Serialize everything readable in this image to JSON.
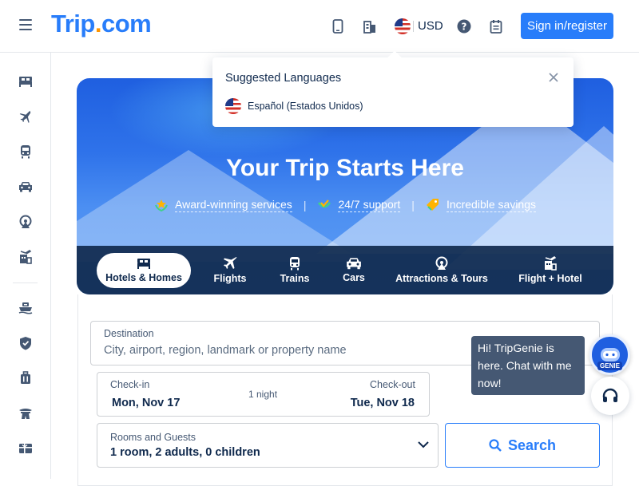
{
  "header": {
    "logo_main": "Trip",
    "logo_dot": ".",
    "logo_tld": "com",
    "currency": "USD",
    "signin_label": "Sign in/register",
    "icons": [
      "menu-icon",
      "mobile-icon",
      "building-icon",
      "us-flag-icon",
      "help-icon",
      "bookings-icon"
    ]
  },
  "sidebar": {
    "items": [
      "hotels-icon",
      "flights-icon",
      "trains-icon",
      "cars-icon",
      "attractions-icon",
      "flight-hotel-icon",
      "cruise-icon",
      "insurance-icon",
      "luggage-icon",
      "landmark-icon",
      "gift-card-icon"
    ]
  },
  "hero": {
    "title": "Your Trip Starts Here",
    "features": [
      {
        "label": "Award-winning services",
        "icon": "award-icon"
      },
      {
        "label": "24/7 support",
        "icon": "support-check-icon"
      },
      {
        "label": "Incredible savings",
        "icon": "tag-icon"
      }
    ],
    "separator": "|",
    "tabs": [
      {
        "label": "Hotels & Homes",
        "active": true
      },
      {
        "label": "Flights"
      },
      {
        "label": "Trains"
      },
      {
        "label": "Cars"
      },
      {
        "label": "Attractions & Tours"
      },
      {
        "label": "Flight + Hotel"
      }
    ]
  },
  "search": {
    "destination_label": "Destination",
    "destination_placeholder": "City, airport, region, landmark or property name",
    "checkin_label": "Check-in",
    "checkin_value": "Mon, Nov 17",
    "nights": "1 night",
    "checkout_label": "Check-out",
    "checkout_value": "Tue, Nov 18",
    "rooms_label": "Rooms and Guests",
    "rooms_value": "1 room, 2 adults, 0 children",
    "search_label": "Search"
  },
  "language_popup": {
    "title": "Suggested Languages",
    "option": "Español (Estados Unidos)"
  },
  "genie": {
    "message": "Hi! TripGenie is here. Chat with me now!",
    "badge": "GENIE"
  },
  "colors": {
    "brand": "#287dfa",
    "logo_dot": "#ff9500",
    "text": "#0f294d",
    "tab_bar": "#0f294d"
  }
}
